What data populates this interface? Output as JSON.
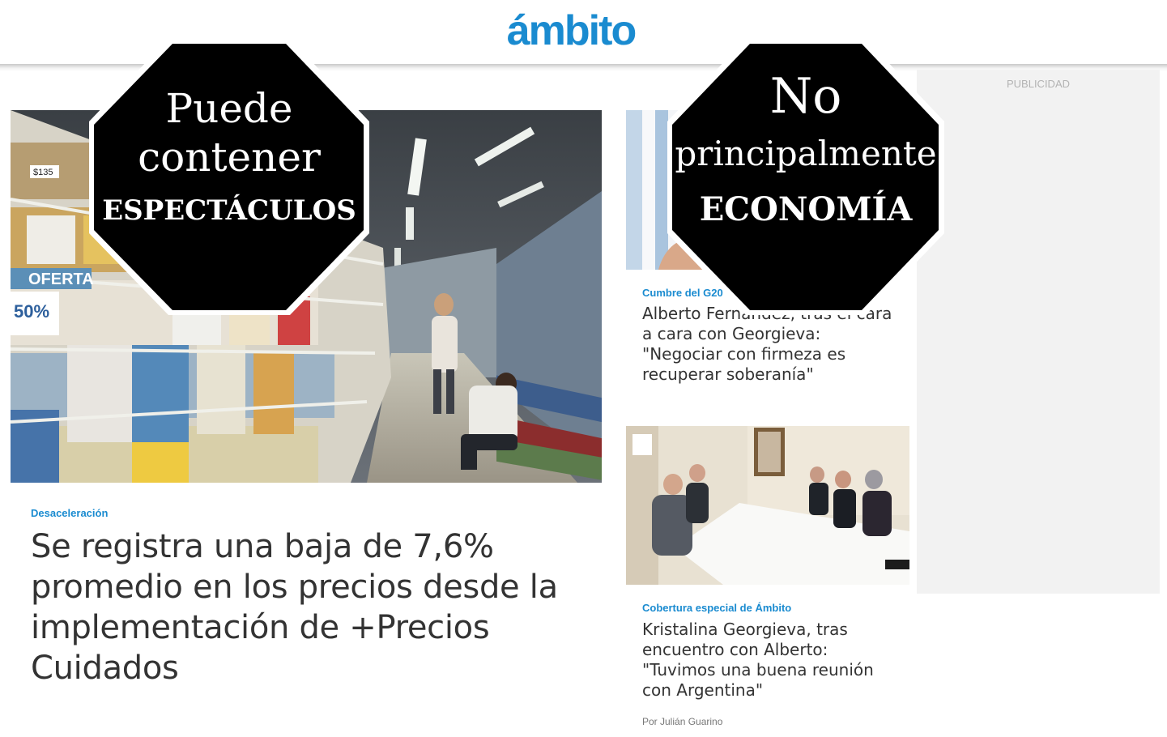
{
  "header": {
    "logo_text": "ámbito",
    "brand_color": "#1a8bd0"
  },
  "ad": {
    "label": "PUBLICIDAD"
  },
  "main_article": {
    "kicker": "Desaceleración",
    "title": "Se registra una baja de 7,6% promedio en los precios desde la implementación de +Precios Cuidados",
    "image_icon": "supermarket-photo",
    "photo_sign_left": "OFERTA",
    "photo_sign_discount": "50%",
    "photo_price_tag": "$135"
  },
  "side_articles": [
    {
      "kicker": "Cumbre del G20",
      "title": "Alberto Fernández, tras el cara a cara con Georgieva: \"Negociar con firmeza es recuperar soberanía\"",
      "image_icon": "president-photo"
    },
    {
      "kicker": "Cobertura especial de Ámbito",
      "title": "Kristalina Georgieva, tras encuentro con Alberto: \"Tuvimos una buena reunión con Argentina\"",
      "author": "Por Julián Guarino",
      "image_icon": "meeting-photo"
    }
  ],
  "stamps": [
    {
      "line1": "Puede",
      "line2": "contener",
      "line3": "ESPECTÁCULOS"
    },
    {
      "line1": "No",
      "line2": "principalmente",
      "line3": "ECONOMÍA"
    }
  ]
}
